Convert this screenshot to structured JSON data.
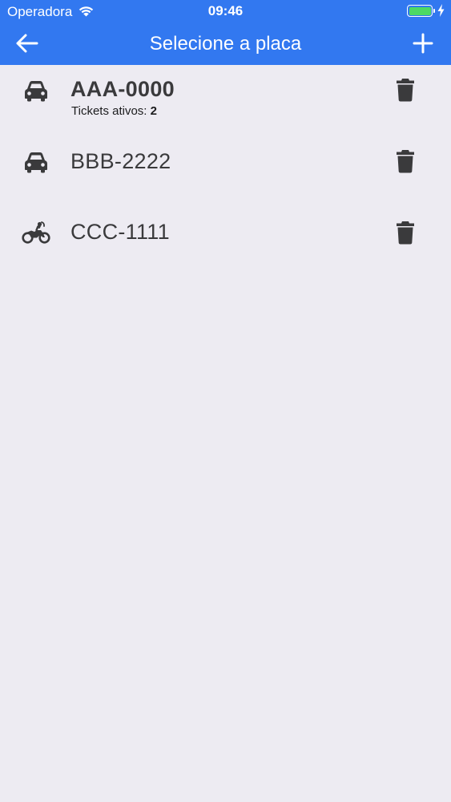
{
  "status_bar": {
    "carrier": "Operadora",
    "time": "09:46",
    "wifi_icon": "wifi-icon",
    "battery_icon": "battery-icon",
    "battery_level": 1.0,
    "charging_icon": "charging-bolt-icon"
  },
  "nav": {
    "title": "Selecione a placa",
    "back_icon": "arrow-left-icon",
    "add_icon": "plus-icon"
  },
  "plates": [
    {
      "plate": "AAA-0000",
      "vehicle_icon": "car-icon",
      "highlighted": true,
      "tickets_label": "Tickets ativos: ",
      "tickets_count": "2",
      "delete_icon": "trash-icon"
    },
    {
      "plate": "BBB-2222",
      "vehicle_icon": "car-icon",
      "highlighted": false,
      "delete_icon": "trash-icon"
    },
    {
      "plate": "CCC-1111",
      "vehicle_icon": "motorcycle-icon",
      "highlighted": false,
      "delete_icon": "trash-icon"
    }
  ],
  "colors": {
    "primary": "#3278F0",
    "background": "#EDEBF2",
    "text": "#3A3A3C",
    "battery": "#4CD964"
  }
}
